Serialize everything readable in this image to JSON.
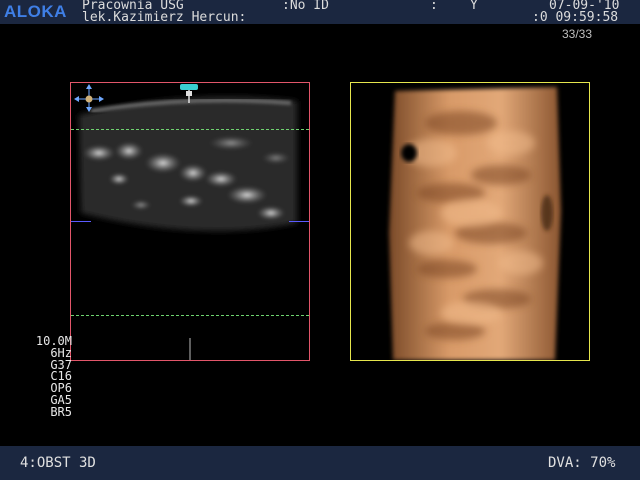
{
  "header": {
    "brand": "ALOKA",
    "institution": "Pracownia USG",
    "patient_id": ":No ID",
    "operator": "lek.Kazimierz Hercun:",
    "field_sep": ":",
    "field_y": "Y",
    "date": "07-09-'10",
    "time": ":0 09:59:58",
    "frame_counter": "33/33"
  },
  "params": [
    "10.0M",
    "6Hz",
    "G37",
    "C16",
    "OP6",
    "GA5",
    "BR5"
  ],
  "footer": {
    "mode": "4:OBST 3D",
    "dva": "DVA: 70%"
  },
  "colors": {
    "topbar": "#1b2740",
    "logo": "#3f7fe6",
    "panel_a_border": "#e2566a",
    "panel_b_border": "#e6e64d",
    "guide_lines": "#6fd36f",
    "render_tone": "#c88a5a"
  }
}
